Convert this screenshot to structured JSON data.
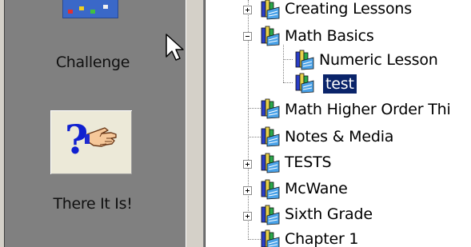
{
  "toolbar": {
    "challenge_label": "Challenge",
    "there_it_is_label": "There It Is!"
  },
  "tree": {
    "items": [
      {
        "label": "Creating Lessons",
        "expander": "plus"
      },
      {
        "label": "Math Basics",
        "expander": "minus"
      },
      {
        "label": "Numeric Lesson",
        "expander": "none"
      },
      {
        "label": "test",
        "expander": "none",
        "selected": true
      },
      {
        "label": "Math Higher Order Thi",
        "expander": "none"
      },
      {
        "label": "Notes & Media",
        "expander": "none"
      },
      {
        "label": "TESTS",
        "expander": "plus"
      },
      {
        "label": "McWane",
        "expander": "plus"
      },
      {
        "label": "Sixth Grade",
        "expander": "plus"
      },
      {
        "label": "Chapter 1",
        "expander": "none"
      }
    ]
  },
  "colors": {
    "toolbar_bg": "#808080",
    "selection_bg": "#0a246a",
    "selection_fg": "#ffffff"
  },
  "icons": {
    "top_button": "challenge-icon",
    "there_it_is": "pointing-hand-question-icon",
    "tree_item": "lesson-books-icon",
    "cursor": "mouse-pointer-icon"
  }
}
